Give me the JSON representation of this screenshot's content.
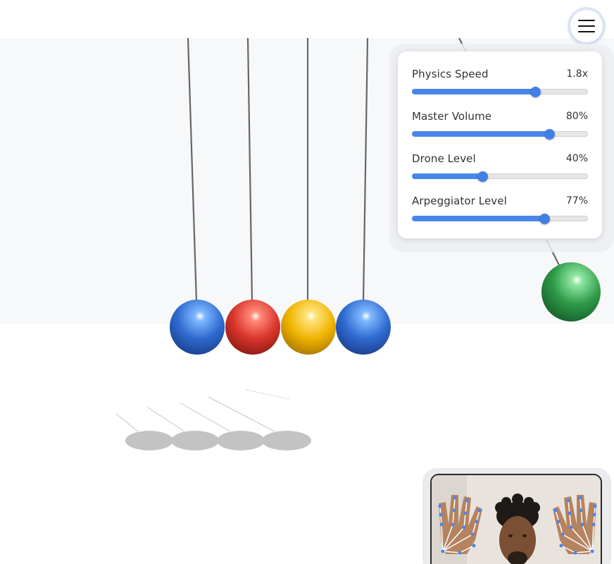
{
  "app": {
    "menu_icon": "hamburger-menu-icon"
  },
  "controls": [
    {
      "label": "Physics Speed",
      "value": "1.8x",
      "level": 0.7
    },
    {
      "label": "Master Volume",
      "value": "80%",
      "level": 0.78
    },
    {
      "label": "Drone Level",
      "value": "40%",
      "level": 0.4
    },
    {
      "label": "Arpeggiator Level",
      "value": "77%",
      "level": 0.75
    }
  ],
  "balls": [
    {
      "color": "#2f6ad0",
      "highlight": "#7fb8ff",
      "shade": "#1a3f8a"
    },
    {
      "color": "#d9352b",
      "highlight": "#ff8a7a",
      "shade": "#8a1a14"
    },
    {
      "color": "#f0b400",
      "highlight": "#ffe37a",
      "shade": "#a67400"
    },
    {
      "color": "#2f6ad0",
      "highlight": "#7fb8ff",
      "shade": "#1a3f8a"
    },
    {
      "color": "#2e9a48",
      "highlight": "#8ee6a0",
      "shade": "#17602a"
    }
  ],
  "colors": {
    "accent": "#4a86e8",
    "wall": "#f7f8fa",
    "string": "#666666",
    "shadow": "#bdbdbd"
  },
  "webcam": {
    "landmark_color": "#4a86e8",
    "skeleton_color": "#ffffff"
  }
}
